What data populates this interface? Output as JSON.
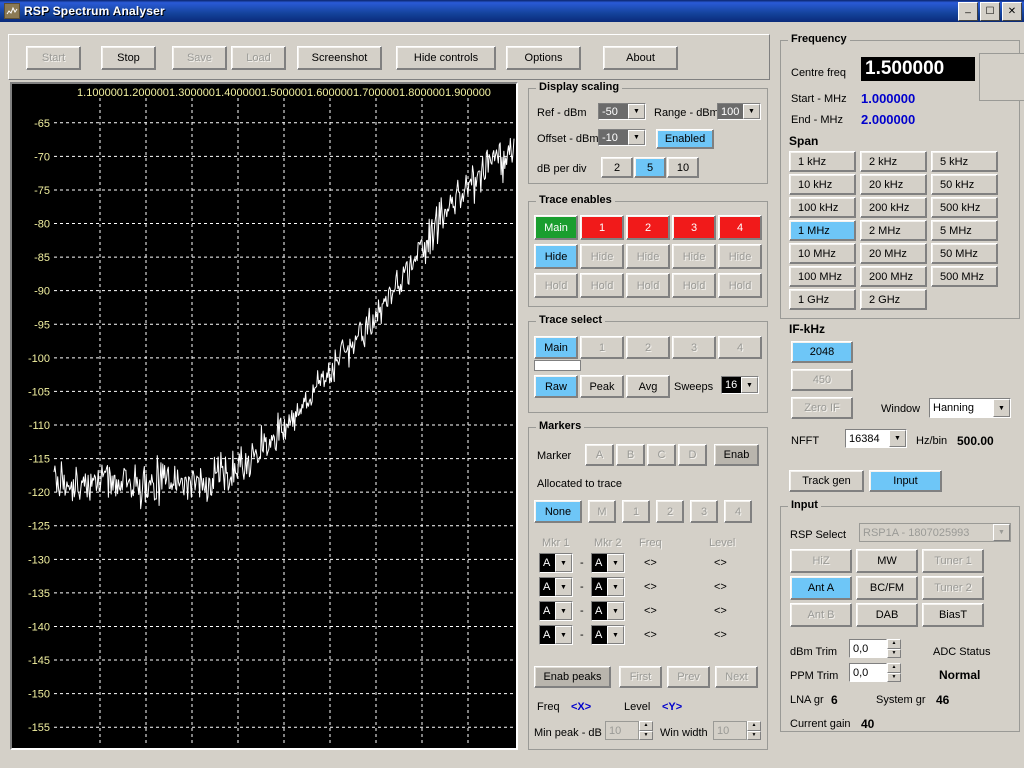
{
  "window": {
    "title": "RSP Spectrum Analyser",
    "icon": "app-icon",
    "minimize": "_",
    "maximize": "□",
    "close": "×"
  },
  "toolbar": {
    "buttons": [
      {
        "label": "Start",
        "enabled": false
      },
      {
        "label": "Stop",
        "enabled": true
      },
      {
        "label": "Save",
        "enabled": false
      },
      {
        "label": "Load",
        "enabled": false
      },
      {
        "label": "Screenshot",
        "enabled": true
      },
      {
        "label": "Hide controls",
        "enabled": true
      },
      {
        "label": "Options",
        "enabled": true
      },
      {
        "label": "About",
        "enabled": true
      }
    ]
  },
  "chart_data": {
    "type": "line",
    "title": "",
    "xlabel": "",
    "ylabel": "",
    "grid": true,
    "legend": "none",
    "bg": "#000000",
    "trace_color": "#ffffff",
    "grid_color": "#ffffff",
    "tick_color": "#f2f0a0",
    "xlim": [
      1.0,
      2.0
    ],
    "ylim": [
      -157.5,
      -62.5
    ],
    "xticks": [
      "1.100000",
      "1.200000",
      "1.300000",
      "1.400000",
      "1.500000",
      "1.600000",
      "1.700000",
      "1.800000",
      "1.900000"
    ],
    "xtick_values": [
      1.1,
      1.2,
      1.3,
      1.4,
      1.5,
      1.6,
      1.7,
      1.8,
      1.9
    ],
    "yticks": [
      -65,
      -70,
      -75,
      -80,
      -85,
      -90,
      -95,
      -100,
      -105,
      -110,
      -115,
      -120,
      -125,
      -130,
      -135,
      -140,
      -145,
      -150,
      -155
    ],
    "series": [
      {
        "name": "Main",
        "description": "Noise floor near -118 dBm from 1.00-1.38 MHz, rising S-curve to approximately -70 dBm at 2.00 MHz",
        "x": [
          1.0,
          1.02,
          1.04,
          1.06,
          1.08,
          1.1,
          1.12,
          1.14,
          1.16,
          1.18,
          1.2,
          1.22,
          1.24,
          1.26,
          1.28,
          1.3,
          1.32,
          1.34,
          1.36,
          1.38,
          1.4,
          1.42,
          1.44,
          1.46,
          1.48,
          1.5,
          1.52,
          1.54,
          1.56,
          1.58,
          1.6,
          1.62,
          1.64,
          1.66,
          1.68,
          1.7,
          1.72,
          1.74,
          1.76,
          1.78,
          1.8,
          1.82,
          1.84,
          1.86,
          1.88,
          1.9,
          1.92,
          1.94,
          1.96,
          1.98,
          2.0
        ],
        "y": [
          -117.5,
          -118.5,
          -119.0,
          -119.5,
          -118.5,
          -118.0,
          -118.5,
          -119.0,
          -118.0,
          -118.5,
          -119.5,
          -118.5,
          -118.5,
          -119.0,
          -118.0,
          -118.5,
          -119.0,
          -118.0,
          -117.0,
          -117.5,
          -116.0,
          -115.5,
          -114.5,
          -113.0,
          -111.5,
          -110.0,
          -108.5,
          -107.0,
          -105.5,
          -104.0,
          -102.0,
          -100.0,
          -98.5,
          -97.0,
          -95.5,
          -94.0,
          -92.0,
          -90.0,
          -88.0,
          -86.0,
          -84.0,
          -81.5,
          -79.5,
          -77.5,
          -76.0,
          -74.5,
          -73.0,
          -71.5,
          -71.0,
          -70.5,
          -70.0
        ]
      }
    ]
  },
  "display_scaling": {
    "title": "Display scaling",
    "ref_label": "Ref - dBm",
    "ref_value": "-50",
    "range_label": "Range - dBm",
    "range_value": "100",
    "offset_label": "Offset - dBm",
    "offset_value": "-10",
    "enabled_label": "Enabled",
    "enabled_selected": true,
    "db_per_div_label": "dB per div",
    "db_per_div_options": [
      "2",
      "5",
      "10"
    ],
    "db_per_div_selected": "5"
  },
  "trace_enables": {
    "title": "Trace enables",
    "traces": [
      {
        "label": "Main",
        "state": "on",
        "color": "#1a9e2e"
      },
      {
        "label": "1",
        "state": "off",
        "color": "#f11a1a"
      },
      {
        "label": "2",
        "state": "off",
        "color": "#f11a1a"
      },
      {
        "label": "3",
        "state": "off",
        "color": "#f11a1a"
      },
      {
        "label": "4",
        "state": "off",
        "color": "#f11a1a"
      }
    ],
    "hide_label": "Hide",
    "hide_selected_index": 0,
    "hold_label": "Hold"
  },
  "trace_select": {
    "title": "Trace select",
    "options": [
      "Main",
      "1",
      "2",
      "3",
      "4"
    ],
    "selected": "Main",
    "swatch_color": "#ffffff",
    "modes": [
      "Raw",
      "Peak",
      "Avg"
    ],
    "mode_selected": "Raw",
    "sweeps_label": "Sweeps",
    "sweeps_value": "16"
  },
  "markers": {
    "title": "Markers",
    "marker_label": "Marker",
    "marker_buttons": [
      "A",
      "B",
      "C",
      "D"
    ],
    "enab_label": "Enab",
    "allocated_label": "Allocated to trace",
    "allocated_options": [
      "None",
      "M",
      "1",
      "2",
      "3",
      "4"
    ],
    "allocated_selected": "None",
    "col_mkr1": "Mkr 1",
    "col_mkr2": "Mkr 2",
    "col_freq": "Freq",
    "col_level": "Level",
    "dash": "-",
    "rows": [
      {
        "mkr1": "A",
        "mkr2": "A",
        "freq": "<>",
        "level": "<>"
      },
      {
        "mkr1": "A",
        "mkr2": "A",
        "freq": "<>",
        "level": "<>"
      },
      {
        "mkr1": "A",
        "mkr2": "A",
        "freq": "<>",
        "level": "<>"
      },
      {
        "mkr1": "A",
        "mkr2": "A",
        "freq": "<>",
        "level": "<>"
      }
    ],
    "enab_peaks_label": "Enab peaks",
    "first_label": "First",
    "prev_label": "Prev",
    "next_label": "Next",
    "peak_freq_label": "Freq",
    "peak_freq_value": "<X>",
    "peak_level_label": "Level",
    "peak_level_value": "<Y>",
    "min_peak_label": "Min peak - dB",
    "min_peak_value": "10",
    "win_width_label": "Win width",
    "win_width_value": "10"
  },
  "frequency": {
    "title": "Frequency",
    "centre_label": "Centre freq",
    "centre_value": "1.500000",
    "start_label": "Start - MHz",
    "start_value": "1.000000",
    "end_label": "End - MHz",
    "end_value": "2.000000",
    "span_label": "Span",
    "span_options": [
      "1 kHz",
      "2 kHz",
      "5 kHz",
      "10 kHz",
      "20 kHz",
      "50 kHz",
      "100 kHz",
      "200 kHz",
      "500 kHz",
      "1 MHz",
      "2 MHz",
      "5 MHz",
      "10 MHz",
      "20 MHz",
      "50 MHz",
      "100 MHz",
      "200 MHz",
      "500 MHz",
      "1 GHz",
      "2 GHz"
    ],
    "span_selected": "1 MHz"
  },
  "if_section": {
    "title": "IF-kHz",
    "options": [
      {
        "label": "2048",
        "selected": true,
        "enabled": true
      },
      {
        "label": "450",
        "selected": false,
        "enabled": false
      }
    ],
    "zero_if_label": "Zero IF",
    "zero_if_enabled": false,
    "window_label": "Window",
    "window_value": "Hanning",
    "nfft_label": "NFFT",
    "nfft_value": "16384",
    "hz_per_bin_label": "Hz/bin",
    "hz_per_bin_value": "500.00"
  },
  "mode": {
    "track_gen_label": "Track gen",
    "input_label": "Input",
    "selected": "Input"
  },
  "input": {
    "title": "Input",
    "rsp_select_label": "RSP Select",
    "rsp_select_value": "RSP1A - 1807025993",
    "buttons": [
      {
        "label": "HiZ",
        "enabled": false,
        "selected": false
      },
      {
        "label": "MW",
        "enabled": true,
        "selected": false
      },
      {
        "label": "Tuner 1",
        "enabled": false,
        "selected": false
      },
      {
        "label": "Ant A",
        "enabled": true,
        "selected": true
      },
      {
        "label": "BC/FM",
        "enabled": true,
        "selected": false
      },
      {
        "label": "Tuner 2",
        "enabled": false,
        "selected": false
      },
      {
        "label": "Ant B",
        "enabled": false,
        "selected": false
      },
      {
        "label": "DAB",
        "enabled": true,
        "selected": false
      },
      {
        "label": "BiasT",
        "enabled": true,
        "selected": false
      }
    ],
    "dbm_trim_label": "dBm Trim",
    "dbm_trim_value": "0,0",
    "ppm_trim_label": "PPM Trim",
    "ppm_trim_value": "0,0",
    "adc_status_label": "ADC Status",
    "adc_status_value": "Normal",
    "lna_label": "LNA gr",
    "lna_value": "6",
    "system_gr_label": "System gr",
    "system_gr_value": "46",
    "current_gain_label": "Current gain",
    "current_gain_value": "40"
  }
}
